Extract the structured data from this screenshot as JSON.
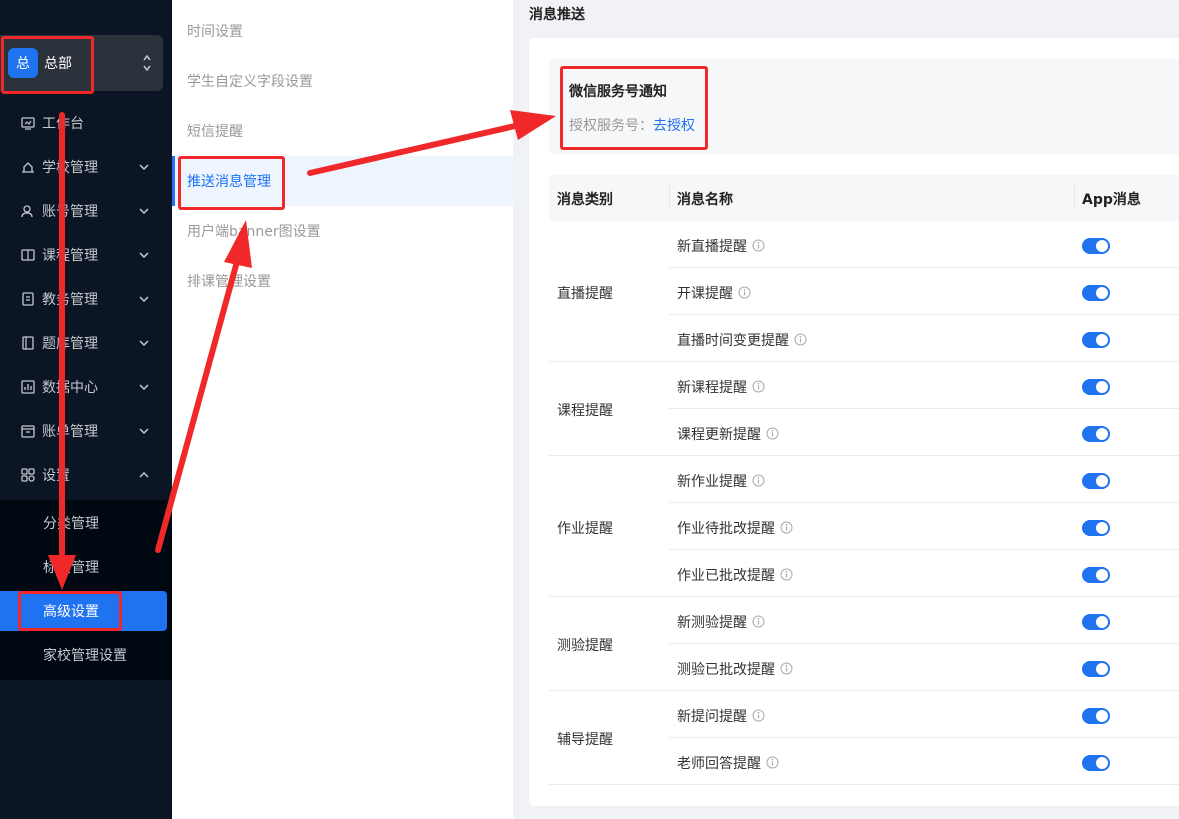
{
  "sidebar": {
    "org": {
      "avatar_text": "总",
      "name": "总部"
    },
    "items": [
      {
        "label": "工作台",
        "icon": "dashboard-icon"
      },
      {
        "label": "学校管理",
        "icon": "school-icon"
      },
      {
        "label": "账号管理",
        "icon": "user-icon"
      },
      {
        "label": "课程管理",
        "icon": "book-icon"
      },
      {
        "label": "教务管理",
        "icon": "affairs-icon"
      },
      {
        "label": "题库管理",
        "icon": "question-bank-icon"
      },
      {
        "label": "数据中心",
        "icon": "chart-icon"
      },
      {
        "label": "账单管理",
        "icon": "bill-icon"
      },
      {
        "label": "设置",
        "icon": "settings-grid-icon"
      }
    ],
    "sub_items": [
      {
        "label": "分类管理"
      },
      {
        "label": "标签管理"
      },
      {
        "label": "高级设置"
      },
      {
        "label": "家校管理设置"
      }
    ]
  },
  "second_menu": {
    "items": [
      {
        "label": "时间设置"
      },
      {
        "label": "学生自定义字段设置"
      },
      {
        "label": "短信提醒"
      },
      {
        "label": "推送消息管理"
      },
      {
        "label": "用户端banner图设置"
      },
      {
        "label": "排课管理设置"
      }
    ]
  },
  "main": {
    "title": "消息推送",
    "wechat": {
      "title": "微信服务号通知",
      "auth_label": "授权服务号：",
      "auth_link": "去授权"
    },
    "table": {
      "headers": [
        "消息类别",
        "消息名称",
        "App消息"
      ],
      "categories": [
        {
          "label": "直播提醒",
          "rows": [
            "新直播提醒",
            "开课提醒",
            "直播时间变更提醒"
          ]
        },
        {
          "label": "课程提醒",
          "rows": [
            "新课程提醒",
            "课程更新提醒"
          ]
        },
        {
          "label": "作业提醒",
          "rows": [
            "新作业提醒",
            "作业待批改提醒",
            "作业已批改提醒"
          ]
        },
        {
          "label": "测验提醒",
          "rows": [
            "新测验提醒",
            "测验已批改提醒"
          ]
        },
        {
          "label": "辅导提醒",
          "rows": [
            "新提问提醒",
            "老师回答提醒"
          ]
        }
      ],
      "toggle_state": "on"
    }
  },
  "colors": {
    "accent": "#1f73f1",
    "annotation": "#f0282a",
    "sidebar_bg": "#0b1524"
  }
}
